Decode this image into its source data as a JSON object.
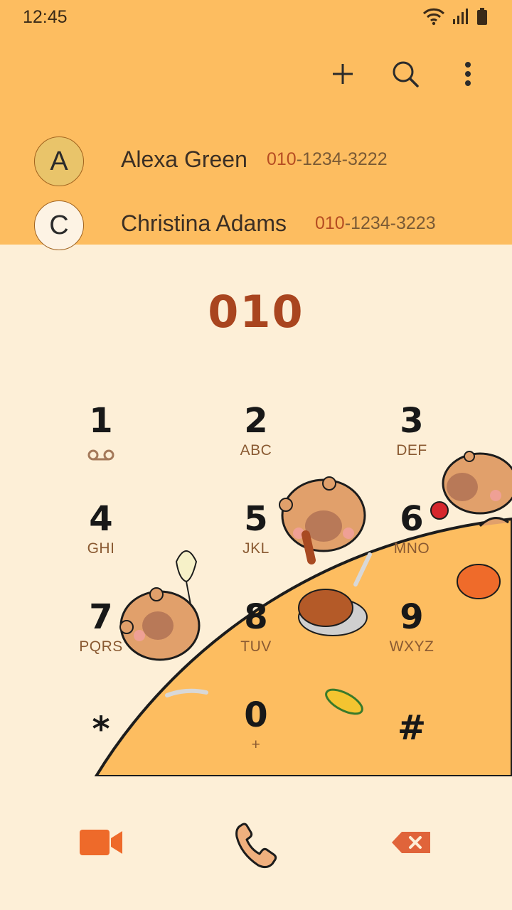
{
  "status": {
    "time": "12:45"
  },
  "toolbar": {
    "add_icon": "plus-icon",
    "search_icon": "search-icon",
    "more_icon": "more-vertical-icon"
  },
  "contacts": [
    {
      "initial": "A",
      "name": "Alexa Green",
      "number_match": "010",
      "number_rest": "-1234-3222",
      "avatar_color": "#e9c46a"
    },
    {
      "initial": "C",
      "name": "Christina Adams",
      "number_match": "010",
      "number_rest": "-1234-3223",
      "avatar_color": "#fdf3e4"
    }
  ],
  "dialer": {
    "entered_number": "010"
  },
  "keys": [
    {
      "digit": "1",
      "letters": ""
    },
    {
      "digit": "2",
      "letters": "ABC"
    },
    {
      "digit": "3",
      "letters": "DEF"
    },
    {
      "digit": "4",
      "letters": "GHI"
    },
    {
      "digit": "5",
      "letters": "JKL"
    },
    {
      "digit": "6",
      "letters": "MNO"
    },
    {
      "digit": "7",
      "letters": "PQRS"
    },
    {
      "digit": "8",
      "letters": "TUV"
    },
    {
      "digit": "9",
      "letters": "WXYZ"
    },
    {
      "digit": "*",
      "letters": ""
    },
    {
      "digit": "0",
      "letters": "+"
    },
    {
      "digit": "#",
      "letters": ""
    }
  ],
  "bottom": {
    "video_icon": "video-call-icon",
    "call_icon": "phone-call-icon",
    "backspace_icon": "backspace-icon"
  },
  "colors": {
    "header_bg": "#fdbd60",
    "body_bg": "#fdefd7",
    "accent": "#a9451f",
    "video": "#ee6a2a"
  }
}
